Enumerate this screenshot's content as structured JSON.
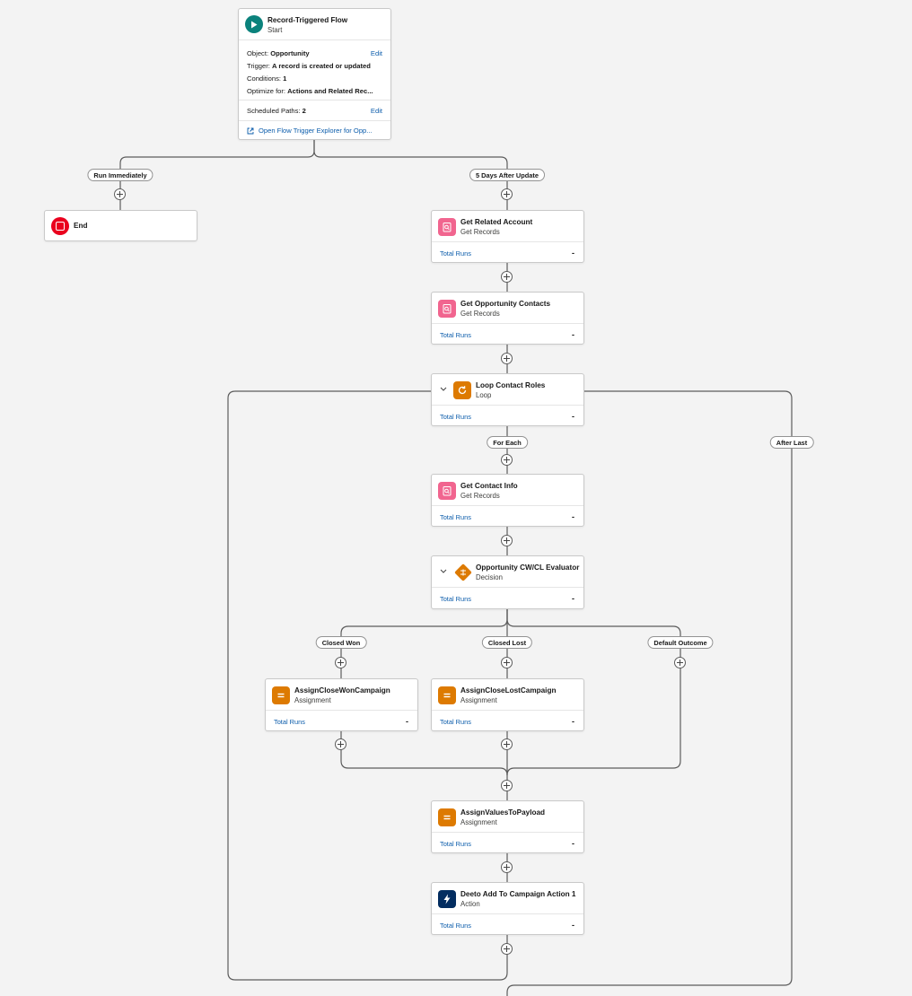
{
  "start": {
    "title": "Record-Triggered Flow",
    "subtitle": "Start",
    "object_label": "Object:",
    "object_value": "Opportunity",
    "trigger_label": "Trigger:",
    "trigger_value": "A record is created or updated",
    "conditions_label": "Conditions:",
    "conditions_value": "1",
    "optimize_label": "Optimize for:",
    "optimize_value": "Actions and Related Rec...",
    "edit_label": "Edit",
    "scheduled_label": "Scheduled Paths:",
    "scheduled_value": "2",
    "scheduled_edit": "Edit",
    "explorer_link": "Open Flow Trigger Explorer for Opp..."
  },
  "paths": {
    "run_immediately": "Run Immediately",
    "five_days": "5 Days After Update",
    "for_each": "For Each",
    "after_last": "After Last",
    "closed_won": "Closed Won",
    "closed_lost": "Closed Lost",
    "default_outcome": "Default Outcome"
  },
  "end": {
    "title": "End"
  },
  "nodes": {
    "get_related_account": {
      "title": "Get Related Account",
      "subtitle": "Get Records",
      "runs_label": "Total Runs",
      "runs_value": "-"
    },
    "get_opp_contacts": {
      "title": "Get Opportunity Contacts",
      "subtitle": "Get Records",
      "runs_label": "Total Runs",
      "runs_value": "-"
    },
    "loop_contact_roles": {
      "title": "Loop Contact Roles",
      "subtitle": "Loop",
      "runs_label": "Total Runs",
      "runs_value": "-"
    },
    "get_contact_info": {
      "title": "Get Contact Info",
      "subtitle": "Get Records",
      "runs_label": "Total Runs",
      "runs_value": "-"
    },
    "decision": {
      "title": "Opportunity CW/CL Evaluator",
      "subtitle": "Decision",
      "runs_label": "Total Runs",
      "runs_value": "-"
    },
    "assign_won": {
      "title": "AssignCloseWonCampaign",
      "subtitle": "Assignment",
      "runs_label": "Total Runs",
      "runs_value": "-"
    },
    "assign_lost": {
      "title": "AssignCloseLostCampaign",
      "subtitle": "Assignment",
      "runs_label": "Total Runs",
      "runs_value": "-"
    },
    "assign_payload": {
      "title": "AssignValuesToPayload",
      "subtitle": "Assignment",
      "runs_label": "Total Runs",
      "runs_value": "-"
    },
    "deeto_action": {
      "title": "Deeto Add To Campaign Action 1",
      "subtitle": "Action",
      "runs_label": "Total Runs",
      "runs_value": "-"
    }
  },
  "colors": {
    "start_icon": "#0b827c",
    "get_records": "#f1658f",
    "loop": "#dd7a01",
    "decision": "#dd7a01",
    "assignment": "#dd7a01",
    "action": "#032d60",
    "end": "#ea001e",
    "link": "#0b5cab"
  }
}
